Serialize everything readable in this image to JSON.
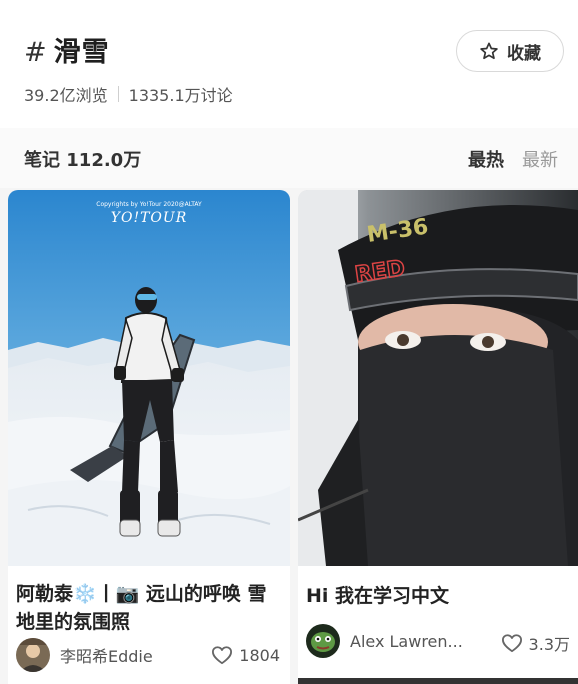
{
  "topic": {
    "hash": "#",
    "title": "滑雪",
    "favorite_label": "收藏",
    "views": "39.2亿浏览",
    "discussions": "1335.1万讨论"
  },
  "notes_bar": {
    "count_label": "笔记 112.0万",
    "sort_hot": "最热",
    "sort_new": "最新"
  },
  "cards": [
    {
      "image_caption": "Copyrights by Yo!Tour 2020@ALTAY",
      "image_logo": "YO!TOUR",
      "title": "阿勒泰❄️丨📷 远山的呼唤 雪地里的氛围照",
      "author": "李昭希Eddie",
      "likes": "1804"
    },
    {
      "helmet_text_1": "M-36",
      "helmet_text_2": "RED",
      "title": "Hi 我在学习中文",
      "author": "Alex Lawren...",
      "likes": "3.3万"
    }
  ],
  "colors": {
    "sky_top": "#2f8fd4",
    "sky_bottom": "#9fd0ef",
    "snow": "#f2f4f7",
    "muted_text": "#999999"
  },
  "icons": {
    "favorite": "star-outline-icon",
    "like": "heart-outline-icon"
  }
}
